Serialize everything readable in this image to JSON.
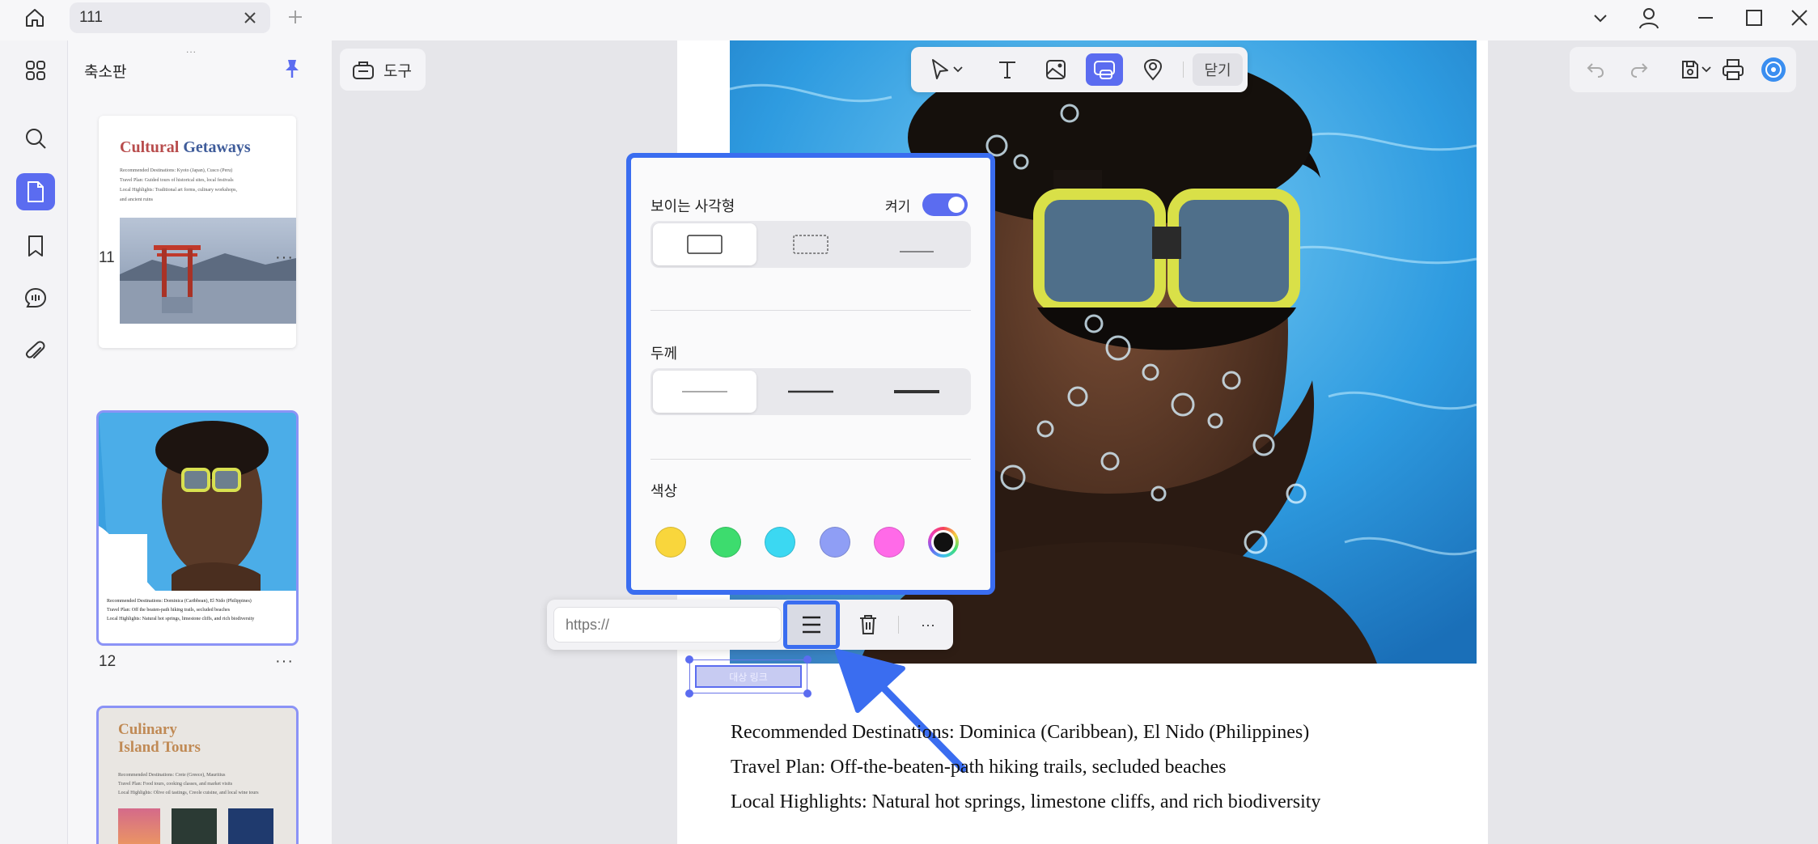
{
  "tabbar": {
    "tab_title": "111"
  },
  "sidebar": {
    "panel_title": "축소판",
    "drag_dots": "...",
    "pages": [
      {
        "number": "11",
        "more": "···",
        "title_a": "Cultural",
        "title_b": "Getaways",
        "lines": [
          "Recommended Destinations: Kyoto (Japan), Cusco (Peru)",
          "Travel Plan: Guided tours of historical sites, local festivals",
          "Local Highlights: Traditional art forms, culinary workshops,",
          "and ancient ruins"
        ]
      },
      {
        "number": "12",
        "more": "···",
        "lines": [
          "Recommended Destinations: Dominica (Caribbean), El Nido (Philippines)",
          "Travel Plan: Off the beaten-path hiking trails, secluded beaches",
          "Local Highlights: Natural hot springs, limestone cliffs, and rich biodiversity"
        ]
      },
      {
        "title_a": "Culinary",
        "title_b": "Island Tours",
        "lines": [
          "Recommended Destinations: Crete (Greece), Mauritius",
          "Travel Plan: Food tours, cooking classes, and market visits",
          "Local Highlights: Olive oil tastings, Creole cuisine, and local wine tours"
        ]
      }
    ]
  },
  "toolbar": {
    "tools_label": "도구",
    "close_label": "닫기"
  },
  "props": {
    "visible_rect_label": "보이는 사각형",
    "toggle_label": "켜기",
    "thickness_label": "두께",
    "color_label": "색상",
    "colors": [
      "#f9d63c",
      "#3ddc6e",
      "#3bd8f2",
      "#8f9ef5",
      "#ff6ae8",
      "#111111"
    ]
  },
  "link_bar": {
    "url_placeholder": "https://",
    "more": "···"
  },
  "link_box": {
    "text": "대상 링크"
  },
  "document": {
    "lines": [
      "Recommended Destinations: Dominica (Caribbean), El Nido (Philippines)",
      "Travel Plan: Off-the-beaten-path hiking trails, secluded beaches",
      "Local Highlights: Natural hot springs, limestone cliffs, and rich biodiversity"
    ]
  },
  "colors": {
    "accent": "#5b6cf0",
    "highlight": "#3a6df0"
  }
}
